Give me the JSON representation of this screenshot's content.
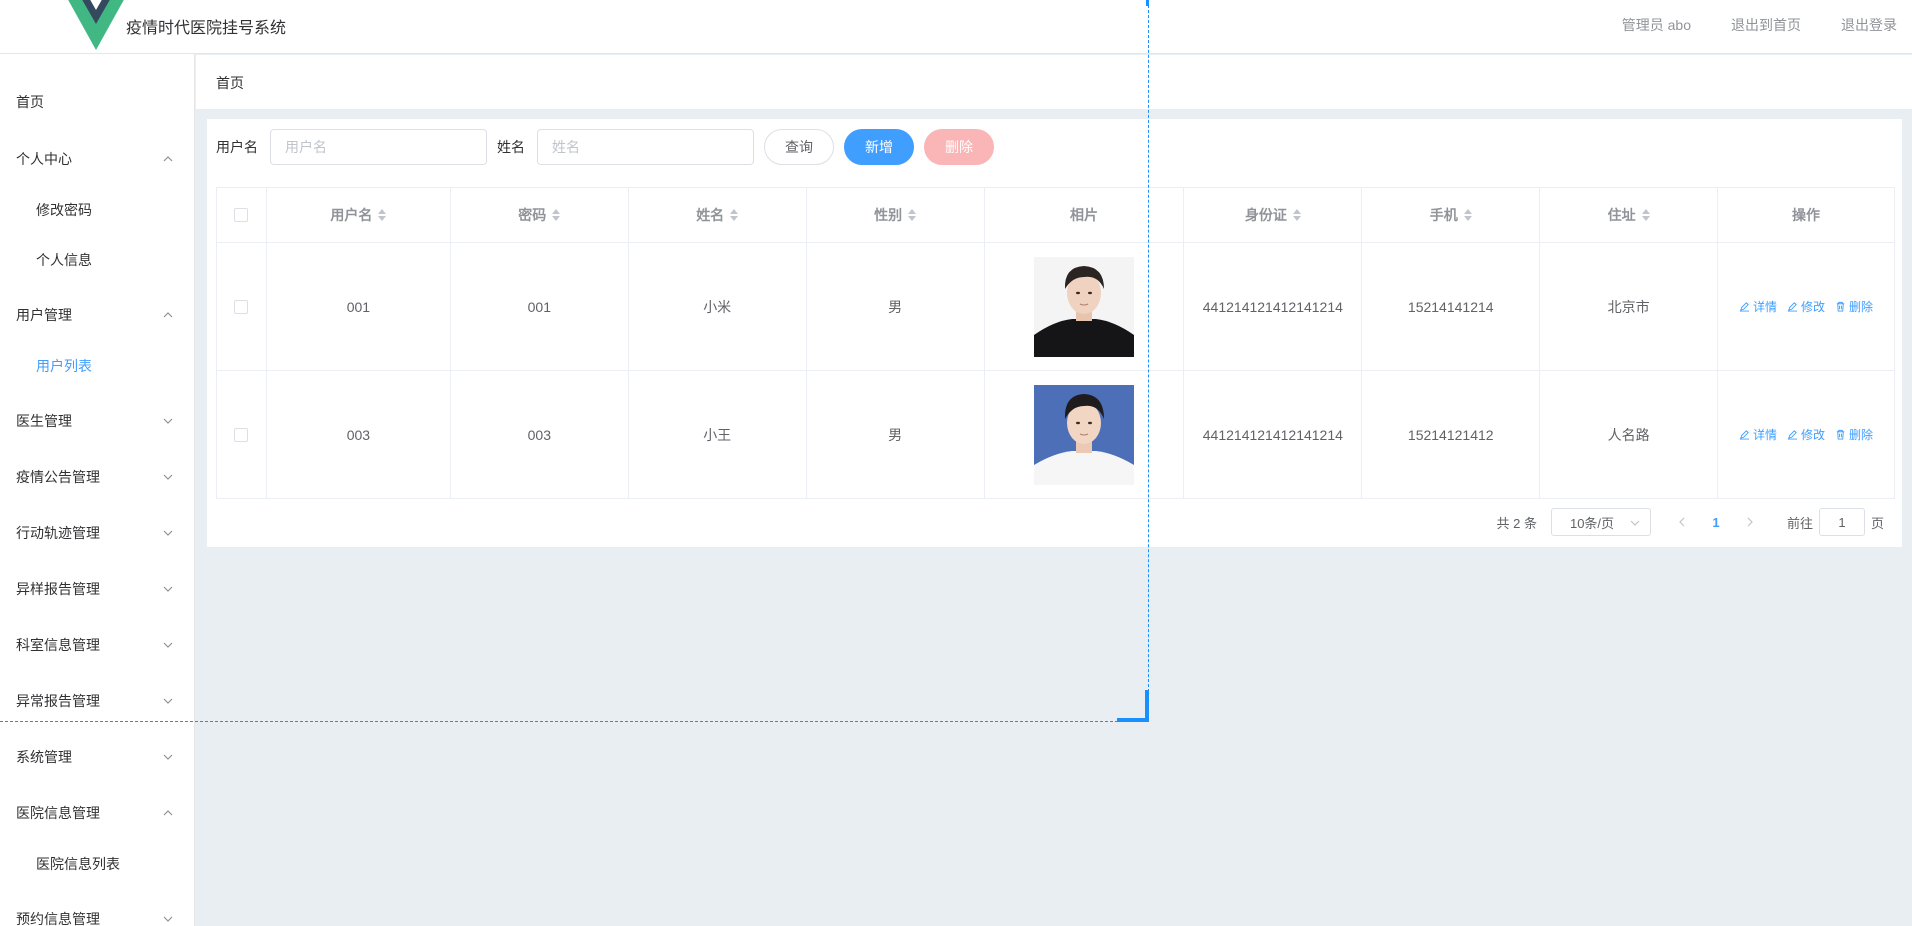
{
  "header": {
    "title": "疫情时代医院挂号系统",
    "admin_label": "管理员 abo",
    "exit_home": "退出到首页",
    "logout": "退出登录",
    "logo_colors": {
      "outer": "#41b883",
      "inner": "#35495e"
    }
  },
  "sidebar": {
    "items": [
      {
        "label": "首页",
        "type": "item"
      },
      {
        "label": "个人中心",
        "type": "group",
        "expanded": true
      },
      {
        "label": "修改密码",
        "type": "sub"
      },
      {
        "label": "个人信息",
        "type": "sub"
      },
      {
        "label": "用户管理",
        "type": "group",
        "expanded": true
      },
      {
        "label": "用户列表",
        "type": "sub",
        "active": true
      },
      {
        "label": "医生管理",
        "type": "group",
        "expanded": false
      },
      {
        "label": "疫情公告管理",
        "type": "group",
        "expanded": false
      },
      {
        "label": "行动轨迹管理",
        "type": "group",
        "expanded": false
      },
      {
        "label": "异样报告管理",
        "type": "group",
        "expanded": false
      },
      {
        "label": "科室信息管理",
        "type": "group",
        "expanded": false
      },
      {
        "label": "异常报告管理",
        "type": "group",
        "expanded": false
      },
      {
        "label": "系统管理",
        "type": "group",
        "expanded": false
      },
      {
        "label": "医院信息管理",
        "type": "group",
        "expanded": true
      },
      {
        "label": "医院信息列表",
        "type": "sub"
      },
      {
        "label": "预约信息管理",
        "type": "group",
        "expanded": false
      }
    ]
  },
  "breadcrumb": "首页",
  "search": {
    "username_label": "用户名",
    "username_placeholder": "用户名",
    "name_label": "姓名",
    "name_placeholder": "姓名",
    "query_button": "查询",
    "add_button": "新增",
    "delete_button": "删除"
  },
  "table": {
    "headers": [
      "用户名",
      "密码",
      "姓名",
      "性别",
      "相片",
      "身份证",
      "手机",
      "住址",
      "操作"
    ],
    "rows": [
      {
        "username": "001",
        "password": "001",
        "name": "小米",
        "gender": "男",
        "photo": "photo-black-shirt",
        "id_card": "441214121412141214",
        "phone": "15214141214",
        "address": "北京市"
      },
      {
        "username": "003",
        "password": "003",
        "name": "小王",
        "gender": "男",
        "photo": "photo-white-shirt-blue-bg",
        "id_card": "441214121412141214",
        "phone": "15214121412",
        "address": "人名路"
      }
    ],
    "actions": {
      "detail": "详情",
      "edit": "修改",
      "delete": "删除"
    }
  },
  "pagination": {
    "total": "共 2 条",
    "page_size": "10条/页",
    "current_page": "1",
    "goto_label": "前往",
    "goto_value": "1",
    "page_suffix": "页"
  },
  "colors": {
    "accent": "#409eff",
    "danger_disabled": "#fab6b6",
    "selection_overlay": "#1890ff"
  }
}
